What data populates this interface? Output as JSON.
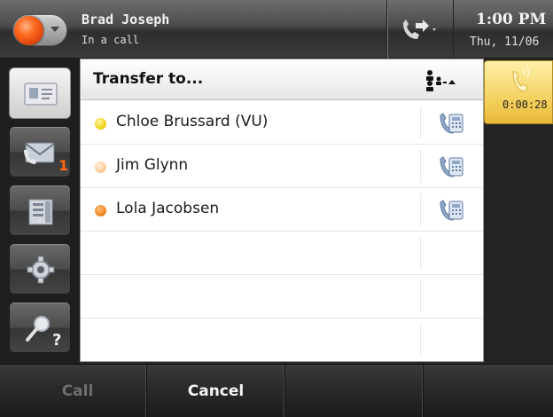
{
  "header": {
    "user_name": "Brad Joseph",
    "user_status": "In a call",
    "time": "1:00 PM",
    "date": "Thu, 11/06"
  },
  "sidebar": {
    "items": [
      {
        "icon": "contact-card-icon",
        "active": true
      },
      {
        "icon": "voicemail-envelope-icon",
        "badge": "1"
      },
      {
        "icon": "directory-book-icon"
      },
      {
        "icon": "settings-gear-icon"
      },
      {
        "icon": "search-help-icon"
      }
    ]
  },
  "panel": {
    "title": "Transfer to...",
    "contacts": [
      {
        "name": "Chloe Brussard (VU)",
        "presence": "yellow"
      },
      {
        "name": "Jim Glynn",
        "presence": "peach"
      },
      {
        "name": "Lola Jacobsen",
        "presence": "orange"
      }
    ]
  },
  "call": {
    "timer": "0:00:28"
  },
  "softkeys": {
    "call": "Call",
    "cancel": "Cancel"
  },
  "colors": {
    "accent_orange": "#f07010",
    "active_call_yellow": "#f2cc55",
    "presence_yellow": "#f2d21a",
    "presence_peach": "#ffcc99",
    "presence_orange": "#f08a20"
  }
}
